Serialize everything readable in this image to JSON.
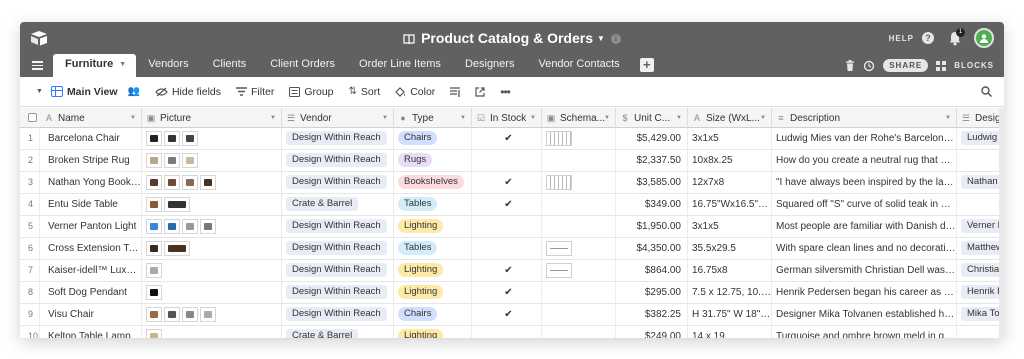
{
  "app": {
    "title": "Product Catalog & Orders",
    "help_label": "HELP",
    "notification_count": "1",
    "share_label": "SHARE",
    "blocks_label": "BLOCKS"
  },
  "tabs": [
    {
      "label": "Furniture",
      "active": true
    },
    {
      "label": "Vendors"
    },
    {
      "label": "Clients"
    },
    {
      "label": "Client Orders"
    },
    {
      "label": "Order Line Items"
    },
    {
      "label": "Designers"
    },
    {
      "label": "Vendor Contacts"
    }
  ],
  "toolbar": {
    "view_name": "Main View",
    "hide_fields": "Hide fields",
    "filter": "Filter",
    "group": "Group",
    "sort": "Sort",
    "color": "Color"
  },
  "columns": [
    {
      "label": "Name",
      "icon": "A"
    },
    {
      "label": "Picture",
      "icon": "▣"
    },
    {
      "label": "Vendor",
      "icon": "☰"
    },
    {
      "label": "Type",
      "icon": "●"
    },
    {
      "label": "In Stock",
      "icon": "☑"
    },
    {
      "label": "Schema...",
      "icon": "▣"
    },
    {
      "label": "Unit C...",
      "icon": "$"
    },
    {
      "label": "Size (WxL...",
      "icon": "A"
    },
    {
      "label": "Description",
      "icon": "≡"
    },
    {
      "label": "Design",
      "icon": "☰"
    }
  ],
  "colors": {
    "topbar": "#616161",
    "accent": "#2d7ff9",
    "type_chairs": "#cfdffc",
    "type_rugs": "#e8dcf7",
    "type_bookshelves": "#fbdbe0",
    "type_tables": "#d3ecf7",
    "type_lighting": "#fdeaa7"
  },
  "rows": [
    {
      "num": "1",
      "name": "Barcelona Chair",
      "vendor": "Design Within Reach",
      "type": "Chairs",
      "in_stock": true,
      "schema": "stripes",
      "price": "$5,429.00",
      "size": "3x1x5",
      "description": "Ludwig Mies van der Rohe's Barcelona C...",
      "designer": "Ludwig M",
      "pics": [
        "#222",
        "#333",
        "#444"
      ]
    },
    {
      "num": "2",
      "name": "Broken Stripe Rug",
      "vendor": "Design Within Reach",
      "type": "Rugs",
      "in_stock": false,
      "schema": "",
      "price": "$2,337.50",
      "size": "10x8x.25",
      "description": "How do you create a neutral rug that also...",
      "designer": "",
      "pics": [
        "#b9a68a",
        "#7d7a74",
        "#c8b9a0"
      ]
    },
    {
      "num": "3",
      "name": "Nathan Yong Bookshelf",
      "vendor": "Design Within Reach",
      "type": "Bookshelves",
      "in_stock": true,
      "schema": "stripes",
      "price": "$3,585.00",
      "size": "12x7x8",
      "description": "\"I have always been inspired by the langu...",
      "designer": "Nathan Yc",
      "pics": [
        "#5a3a2a",
        "#6e4a35",
        "#8a6a52",
        "#4a3020"
      ]
    },
    {
      "num": "4",
      "name": "Entu Side Table",
      "vendor": "Crate & Barrel",
      "type": "Tables",
      "in_stock": true,
      "schema": "",
      "price": "$349.00",
      "size": "16.75\"Wx16.5\"D...",
      "description": "Squared off \"S\" curve of solid teak in a st...",
      "designer": "",
      "pics": [
        "#8a5a30",
        "#333"
      ]
    },
    {
      "num": "5",
      "name": "Verner Panton Light",
      "vendor": "Design Within Reach",
      "type": "Lighting",
      "in_stock": false,
      "schema": "",
      "price": "$1,950.00",
      "size": "3x1x5",
      "description": "Most people are familiar with Danish desi...",
      "designer": "Verner Pa",
      "pics": [
        "#3a86d8",
        "#2b6cb0",
        "#999",
        "#777"
      ]
    },
    {
      "num": "6",
      "name": "Cross Extension Table",
      "vendor": "Design Within Reach",
      "type": "Tables",
      "in_stock": false,
      "schema": "plain",
      "price": "$4,350.00",
      "size": "35.5x29.5",
      "description": "With spare clean lines and no decorative ...",
      "designer": "Matthew H",
      "pics": [
        "#3a2a1e",
        "#4a3222"
      ]
    },
    {
      "num": "7",
      "name": "Kaiser-idell™ Luxus Tabl...",
      "vendor": "Design Within Reach",
      "type": "Lighting",
      "in_stock": true,
      "schema": "plain",
      "price": "$864.00",
      "size": "16.75x8",
      "description": "German silversmith Christian Dell was a ...",
      "designer": "Christian",
      "pics": [
        "#aaa"
      ]
    },
    {
      "num": "8",
      "name": "Soft Dog Pendant",
      "vendor": "Design Within Reach",
      "type": "Lighting",
      "in_stock": true,
      "schema": "",
      "price": "$295.00",
      "size": "7.5 x 12.75, 10.5 ...",
      "description": "Henrik Pedersen began his career as a fa...",
      "designer": "Henrik Pe",
      "pics": [
        "#111"
      ]
    },
    {
      "num": "9",
      "name": "Visu Chair",
      "vendor": "Design Within Reach",
      "type": "Chairs",
      "in_stock": true,
      "schema": "",
      "price": "$382.25",
      "size": "H 31.75\" W 18\" ...",
      "description": "Designer Mika Tolvanen established his ...",
      "designer": "Mika Tolva",
      "pics": [
        "#9a6a40",
        "#555",
        "#888",
        "#aaa"
      ]
    },
    {
      "num": "10",
      "name": "Kelton Table Lamp",
      "vendor": "Crate & Barrel",
      "type": "Lighting",
      "in_stock": false,
      "schema": "",
      "price": "$249.00",
      "size": "14 x 19",
      "description": "Turquoise and ombre brown meld in glos...",
      "designer": "",
      "pics": [
        "#c9b58a"
      ]
    }
  ]
}
